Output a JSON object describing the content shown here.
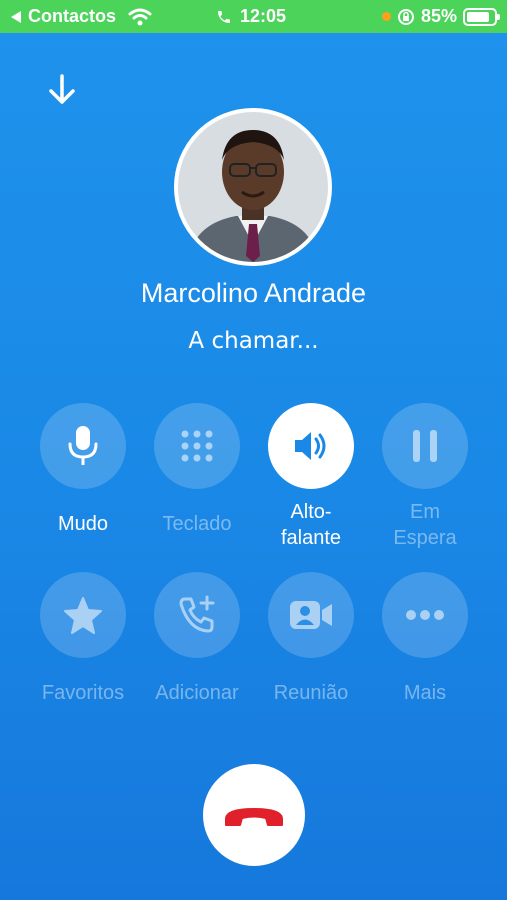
{
  "status_bar": {
    "back_app": "Contactos",
    "time": "12:05",
    "battery": "85%",
    "battery_level": 0.85
  },
  "call": {
    "contact_name": "Marcolino Andrade",
    "status": "A chamar..."
  },
  "controls": {
    "mute": "Mudo",
    "keypad": "Teclado",
    "speaker_line1": "Alto-",
    "speaker_line2": "falante",
    "hold_line1": "Em",
    "hold_line2": "Espera",
    "favorites": "Favoritos",
    "add": "Adicionar",
    "meeting": "Reunião",
    "more": "Mais"
  },
  "colors": {
    "background": "#1a88e6",
    "status_bar": "#4cd35a",
    "end_call_icon": "#e0202a",
    "speaker_icon": "#1a88e6"
  },
  "icons": [
    "back-arrow-icon",
    "wifi-icon",
    "phone-icon",
    "orientation-lock-icon",
    "battery-icon",
    "minimize-arrow-icon",
    "microphone-icon",
    "keypad-icon",
    "speaker-icon",
    "pause-icon",
    "star-icon",
    "add-call-icon",
    "video-meeting-icon",
    "more-icon",
    "end-call-icon"
  ]
}
